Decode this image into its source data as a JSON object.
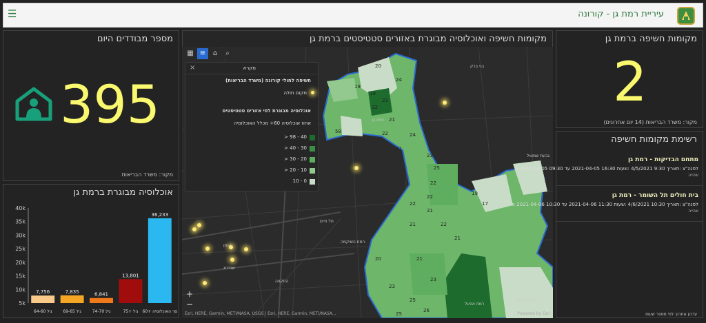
{
  "header": {
    "title": "עיריית רמת גן - קורונה",
    "menu_icon": "hamburger-icon"
  },
  "isolated": {
    "title": "מספר מבודדים היום",
    "value": "395",
    "source": "מקור: משרד הבריאות",
    "icon": "home-person-icon"
  },
  "exposure_count": {
    "title": "מקומות חשיפה ברמת גן",
    "value": "2",
    "source": "מקור: משרד הבריאות (14 יום אחרונים)"
  },
  "map_panel": {
    "title": "מקומות חשיפה ואוכלוסיה מבוגרת באזורים סטטיסטים ברמת גן",
    "legend_header": "מקרא",
    "legend_section1": "חשיפה לחולי קורונה (משרד הבריאות)",
    "legend_exposure_item": "מקום חולה",
    "legend_section2": "אוכלוסיה מבוגרת לפי אזורים סטטיסטים",
    "legend_subtitle": "אחוז אוכלוסיה 60+ מכלל האוכלוסיה",
    "legend_classes": [
      "40 - 98 <",
      "30 - 40 <",
      "20 - 30 <",
      "10 - 20 <",
      "0 - 10"
    ],
    "legend_colors": [
      "#1e6b2e",
      "#3a8f45",
      "#5fae5f",
      "#93c98f",
      "#c9dcc7"
    ],
    "attribution": "Esri, HERE, Garmin, METI/NASA, USGS | Esri, HERE, Garmin, METI/NASA...",
    "powered": "Powered by Esri",
    "zoom_in": "+",
    "zoom_out": "−",
    "place_labels": [
      "בני ברק",
      "רמת גן",
      "גבעת שמואל",
      "תל חיים",
      "רמת השיקמה",
      "הגפן",
      "שפירא",
      "התקווה",
      "רמת אפעל",
      "נחלת יצחק"
    ],
    "zone_values": [
      "20",
      "19",
      "24",
      "19",
      "32",
      "23",
      "21",
      "22",
      "21",
      "24",
      "23",
      "25",
      "22",
      "22",
      "22",
      "21",
      "21",
      "22",
      "19",
      "17",
      "21",
      "21",
      "23",
      "23",
      "25",
      "26",
      "25",
      "20",
      "58"
    ]
  },
  "exposure_list": {
    "title": "רשימת מקומות חשיפה",
    "items": [
      {
        "name": "מתחם הבדיקות - רמת גן",
        "time": "לפנה\"צ :תאריך 9:30 4/5/2021 :שעות 16:30 2021-04-05 עד 09:30 2021-04-05 מ",
        "comment": "שהייה"
      },
      {
        "name": "בית חולים תל השומר - רמת גן",
        "time": "לפנה\"צ :תאריך 10:30 4/6/2021 :שעות 11:30 2021-04-06 עד 10:30 2021-04-06 מ",
        "comment": "שהייה"
      }
    ],
    "footer": "עדכון אחרון: לפי מספר שעות"
  },
  "older_pop": {
    "title": "אוכלוסיה מבוגרת ברמת גן"
  },
  "chart_data": {
    "type": "bar",
    "categories": [
      "גיל 64-60",
      "גיל 69-65",
      "גיל 74-70",
      "גיל +75",
      "סך האוכלוסיה +60"
    ],
    "values": [
      7756,
      7835,
      6841,
      13801,
      36233
    ],
    "value_labels": [
      "7,756",
      "7,835",
      "6,841",
      "13,801",
      "36,233"
    ],
    "colors": [
      "#f9c98a",
      "#f5a623",
      "#f07a1a",
      "#a10d0d",
      "#2bb8f0"
    ],
    "yticks": [
      "5k",
      "10k",
      "15k",
      "20k",
      "25k",
      "30k",
      "35k",
      "40k"
    ],
    "ylim": [
      5000,
      40000
    ]
  },
  "colors": {
    "accent": "#faf86e",
    "brand": "#2f7a3f",
    "dot": "#ffe97a"
  }
}
